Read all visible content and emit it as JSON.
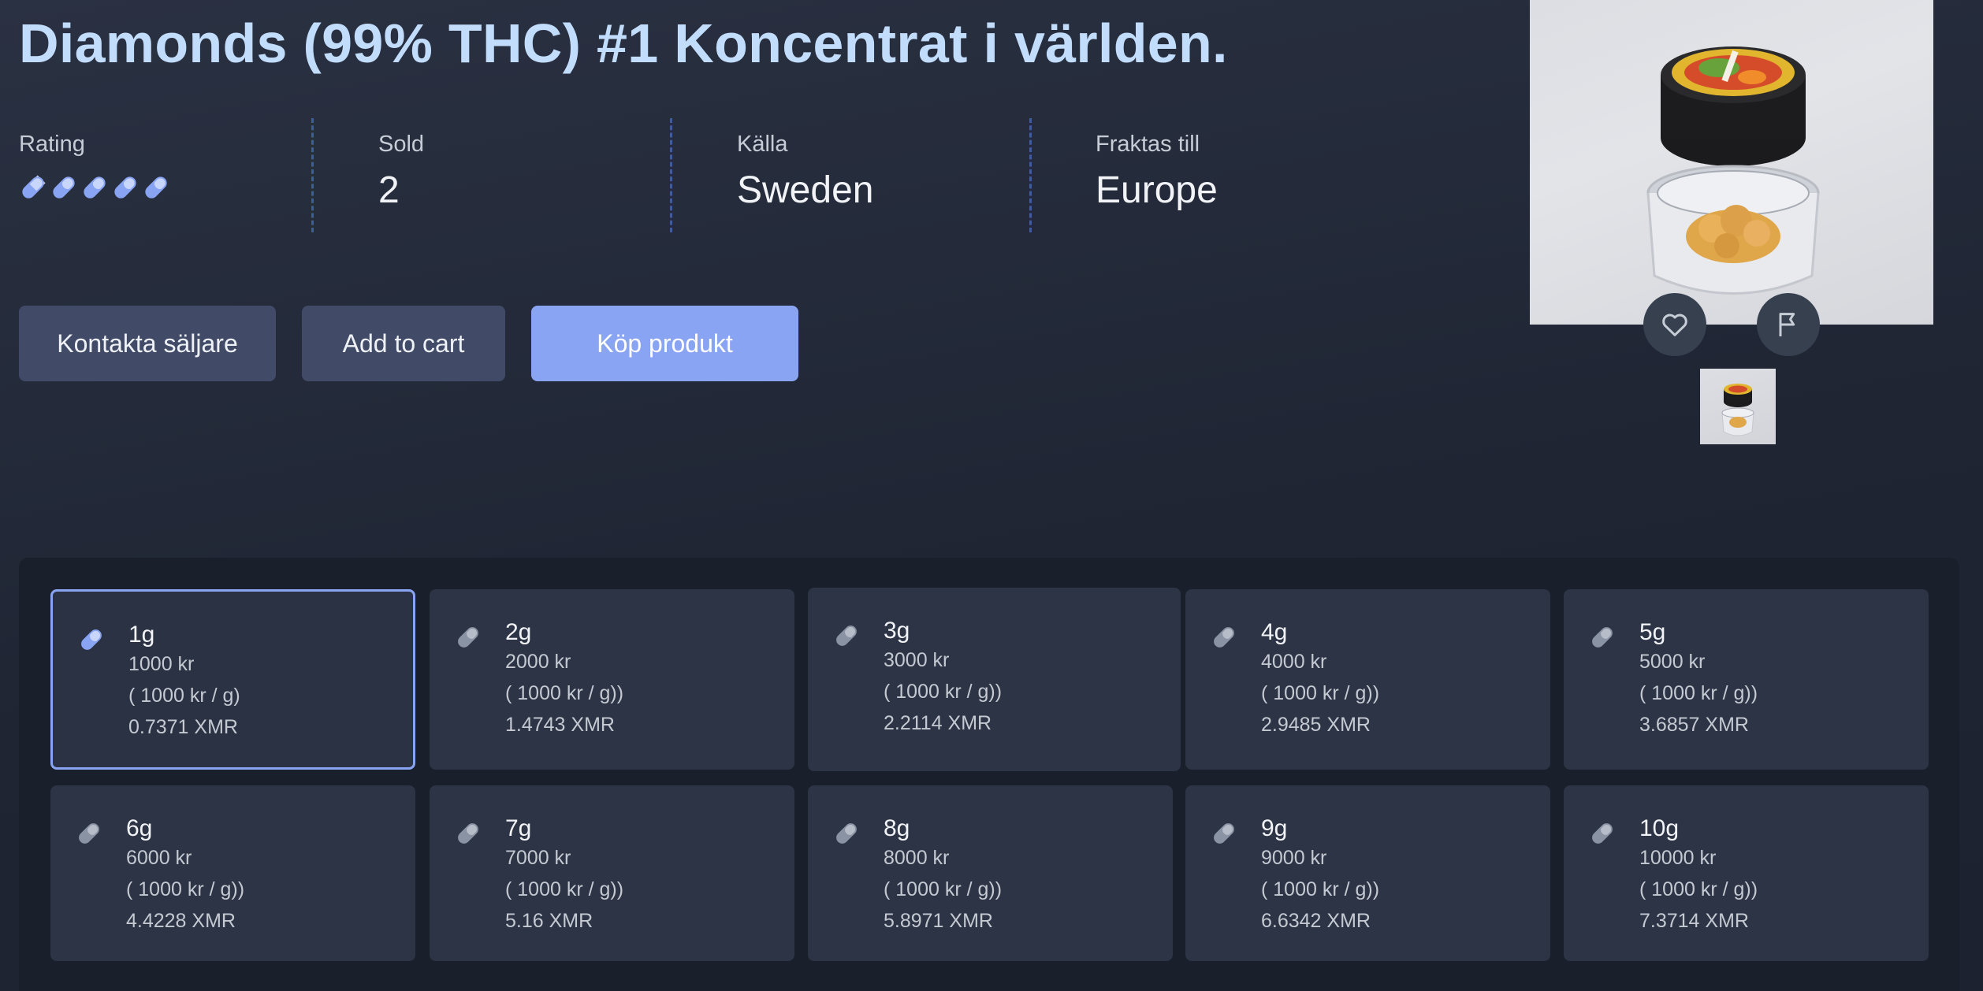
{
  "product": {
    "title": "Diamonds (99% THC) #1 Koncentrat i världen."
  },
  "stats": {
    "rating": {
      "label": "Rating",
      "value": 5,
      "max": 5
    },
    "sold": {
      "label": "Sold",
      "value": "2"
    },
    "source": {
      "label": "Källa",
      "value": "Sweden"
    },
    "ships_to": {
      "label": "Fraktas till",
      "value": "Europe"
    }
  },
  "actions": {
    "contact_label": "Kontakta säljare",
    "cart_label": "Add to cart",
    "buy_label": "Köp produkt"
  },
  "gallery": {
    "favorite_icon": "heart-icon",
    "report_icon": "flag-icon",
    "thumbnail_count": 1
  },
  "colors": {
    "title": "#c2dcfb",
    "accent": "#8aa4f4",
    "pill_active": "#8aa4f4",
    "pill_inactive": "#8a93a3"
  },
  "options": [
    {
      "weight": "1g",
      "price": "1000 kr",
      "unit": "( 1000 kr / g)",
      "xmr": "0.7371 XMR",
      "selected": true
    },
    {
      "weight": "2g",
      "price": "2000 kr",
      "unit": "( 1000 kr / g))",
      "xmr": "1.4743 XMR",
      "selected": false
    },
    {
      "weight": "3g",
      "price": "3000 kr",
      "unit": "( 1000 kr / g))",
      "xmr": "2.2114 XMR",
      "selected": false
    },
    {
      "weight": "4g",
      "price": "4000 kr",
      "unit": "( 1000 kr / g))",
      "xmr": "2.9485 XMR",
      "selected": false
    },
    {
      "weight": "5g",
      "price": "5000 kr",
      "unit": "( 1000 kr / g))",
      "xmr": "3.6857 XMR",
      "selected": false
    },
    {
      "weight": "6g",
      "price": "6000 kr",
      "unit": "( 1000 kr / g))",
      "xmr": "4.4228 XMR",
      "selected": false
    },
    {
      "weight": "7g",
      "price": "7000 kr",
      "unit": "( 1000 kr / g))",
      "xmr": "5.16 XMR",
      "selected": false
    },
    {
      "weight": "8g",
      "price": "8000 kr",
      "unit": "( 1000 kr / g))",
      "xmr": "5.8971 XMR",
      "selected": false
    },
    {
      "weight": "9g",
      "price": "9000 kr",
      "unit": "( 1000 kr / g))",
      "xmr": "6.6342 XMR",
      "selected": false
    },
    {
      "weight": "10g",
      "price": "10000 kr",
      "unit": "( 1000 kr / g))",
      "xmr": "7.3714 XMR",
      "selected": false
    }
  ]
}
